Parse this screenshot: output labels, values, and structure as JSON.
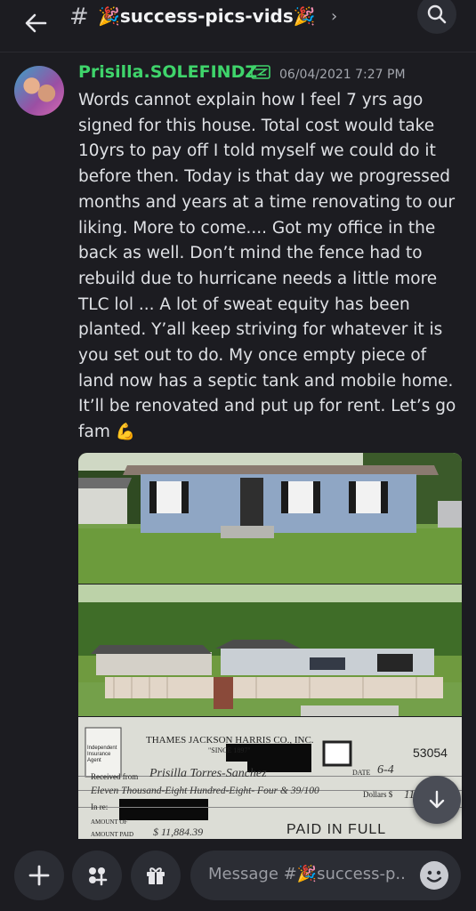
{
  "header": {
    "hash": "#",
    "channel_name": "🎉success-pics-vids🎉",
    "chevron": "›"
  },
  "message": {
    "author": "Prisilla.SOLEFINDZ",
    "timestamp": "06/04/2021 7:27 PM",
    "text": "Words cannot explain how I feel 7 yrs ago signed for this house. Total cost would take 10yrs to pay off I told myself we could do it before then. Today is that day we progressed months and years at a time renovating to our liking. More to come.... Got my office in the back as well. Don’t mind the fence had to rebuild due to hurricane needs a little more TLC lol ... A lot of sweat equity has been planted. Y’all keep striving for whatever it is you set out to do. My once empty piece of land now has a septic tank and mobile home. It’ll be renovated and put up for rent. Let’s go fam",
    "emoji": "💪"
  },
  "receipt": {
    "company": "THAMES JACKSON HARRIS CO., INC.",
    "since": "\"SINCE 1897\"",
    "number": "53054",
    "date_label": "DATE",
    "date_value": "6-4",
    "received_from_label": "Received from",
    "received_from_value": "Prisilla Torres-Sanchez",
    "amount_words": "Eleven Thousand-Eight Hundred-Eight- Four & 39/100",
    "dollars_label": "Dollars $",
    "dollars_value": "11,",
    "in_re_label": "In re:",
    "amount_of_label": "AMOUNT OF",
    "amount_paid_label": "AMOUNT PAID",
    "amount_paid_value": "$ 11,884.39",
    "stamp": "PAID IN FULL",
    "agent_text": "Independent Insurance Agent"
  },
  "composer": {
    "placeholder": "Message #🎉success-p.."
  },
  "colors": {
    "background": "#1c1c21",
    "author": "#3fd46b",
    "input_bg": "#2b2d34"
  },
  "icons": {
    "back": "arrow-left-icon",
    "search": "search-icon",
    "add": "plus-icon",
    "apps": "apps-icon",
    "gift": "gift-icon",
    "emoji": "emoji-icon",
    "scroll": "arrow-down-icon"
  }
}
